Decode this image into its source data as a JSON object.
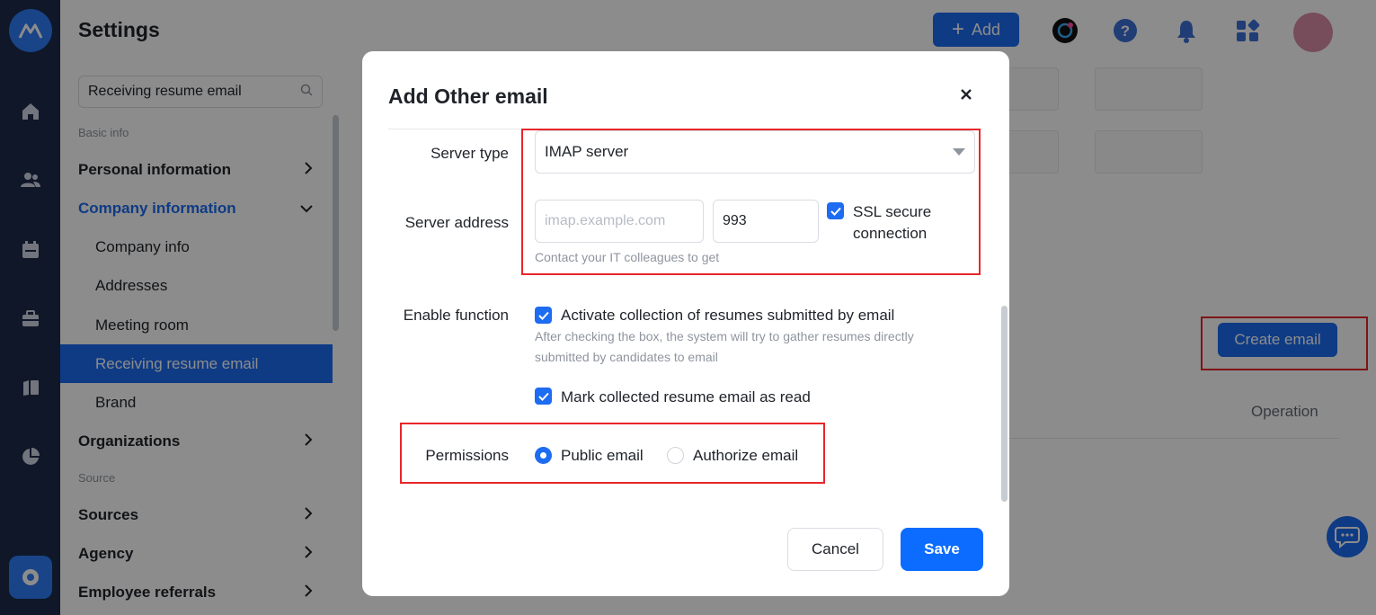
{
  "header": {
    "title": "Settings",
    "add_label": "Add"
  },
  "sidebar": {
    "search_value": "Receiving resume email",
    "groups": {
      "basic_info": "Basic info",
      "source": "Source"
    },
    "items": {
      "personal_information": "Personal information",
      "company_information": "Company information",
      "company_info": "Company info",
      "addresses": "Addresses",
      "meeting_room": "Meeting room",
      "receiving_resume_email": "Receiving resume email",
      "brand": "Brand",
      "organizations": "Organizations",
      "sources": "Sources",
      "agency": "Agency",
      "employee_referrals": "Employee referrals"
    }
  },
  "main": {
    "create_email_label": "Create email",
    "operation_column": "Operation"
  },
  "modal": {
    "title": "Add Other email",
    "server_type_label": "Server type",
    "server_type_value": "IMAP server",
    "server_address_label": "Server address",
    "server_address_placeholder": "imap.example.com",
    "port_value": "993",
    "ssl_label_line1": "SSL secure",
    "ssl_label_line2": "connection",
    "server_hint": "Contact your IT colleagues to get",
    "enable_function_label": "Enable function",
    "activate_collection_label": "Activate collection of resumes submitted by email",
    "activate_hint_line1": "After checking the box, the system will try to gather resumes directly",
    "activate_hint_line2": "submitted by candidates to email",
    "mark_read_label": "Mark collected resume email as read",
    "permissions_label": "Permissions",
    "public_email_label": "Public email",
    "authorize_email_label": "Authorize email",
    "cancel_label": "Cancel",
    "save_label": "Save"
  },
  "colors": {
    "accent": "#1d6cf2",
    "highlight_box": "#e8262a",
    "rail": "#1c2b4a"
  }
}
